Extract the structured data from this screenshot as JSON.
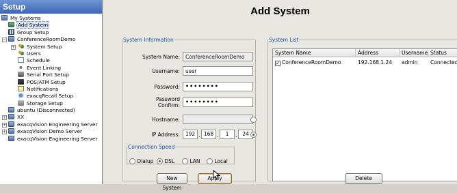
{
  "sidebar": {
    "header": "Setup",
    "items": [
      {
        "label": "My Systems",
        "icon": "systems-icon"
      },
      {
        "label": "Add System",
        "icon": "add-system-icon"
      },
      {
        "label": "Group Setup",
        "icon": "group-icon"
      },
      {
        "label": "ConferenceRoomDemo",
        "icon": "server-icon"
      },
      {
        "label": "System Setup",
        "icon": "system-setup-icon"
      },
      {
        "label": "Users",
        "icon": "users-icon"
      },
      {
        "label": "Schedule",
        "icon": "schedule-icon"
      },
      {
        "label": "Event Linking",
        "icon": "event-link-icon"
      },
      {
        "label": "Serial Port Setup",
        "icon": "serial-port-icon"
      },
      {
        "label": "POS/ATM Setup",
        "icon": "pos-icon"
      },
      {
        "label": "Notifications",
        "icon": "notifications-icon"
      },
      {
        "label": "exacqRecall Setup",
        "icon": "recall-icon"
      },
      {
        "label": "Storage Setup",
        "icon": "storage-icon"
      },
      {
        "label": "ubuntu (Disconnected)",
        "icon": "server-icon"
      },
      {
        "label": "XX",
        "icon": "server-icon"
      },
      {
        "label": "exacqVision Engineering Server",
        "icon": "server-icon"
      },
      {
        "label": "exacqVision Demo Server",
        "icon": "server-icon"
      },
      {
        "label": "exacqVision Engineering Server",
        "icon": "server-icon"
      }
    ]
  },
  "main": {
    "title": "Add System",
    "system_info": {
      "legend": "System Information",
      "system_name_label": "System Name:",
      "system_name_value": "ConferenceRoomDemo",
      "username_label": "Username:",
      "username_value": "user",
      "password_label": "Password:",
      "password_value": "••••••••",
      "confirm_label_line1": "Password",
      "confirm_label_line2": "Confirm:",
      "confirm_value": "••••••••",
      "hostname_label": "Hostname:",
      "hostname_value": "",
      "ip_label": "IP Address:",
      "ip_octets": [
        "192",
        "168",
        "1",
        "24"
      ],
      "speed_legend": "Connection Speed",
      "speed_options": [
        "Dialup",
        "DSL",
        "LAN",
        "Local"
      ],
      "speed_selected": "DSL"
    },
    "buttons": {
      "new_system": "New System",
      "apply": "Apply",
      "delete": "Delete"
    },
    "system_list": {
      "legend": "System List",
      "columns": [
        "System Name",
        "Address",
        "Username",
        "Status"
      ],
      "rows": [
        {
          "checked": true,
          "name": "ConferenceRoomDemo",
          "address": "192.168.1.24",
          "username": "admin",
          "status": "Connected."
        }
      ]
    }
  },
  "colors": {
    "header_blue": "#3b67b4",
    "legend_blue": "#1f4f9a",
    "panel_bg": "#e9e7e1"
  }
}
